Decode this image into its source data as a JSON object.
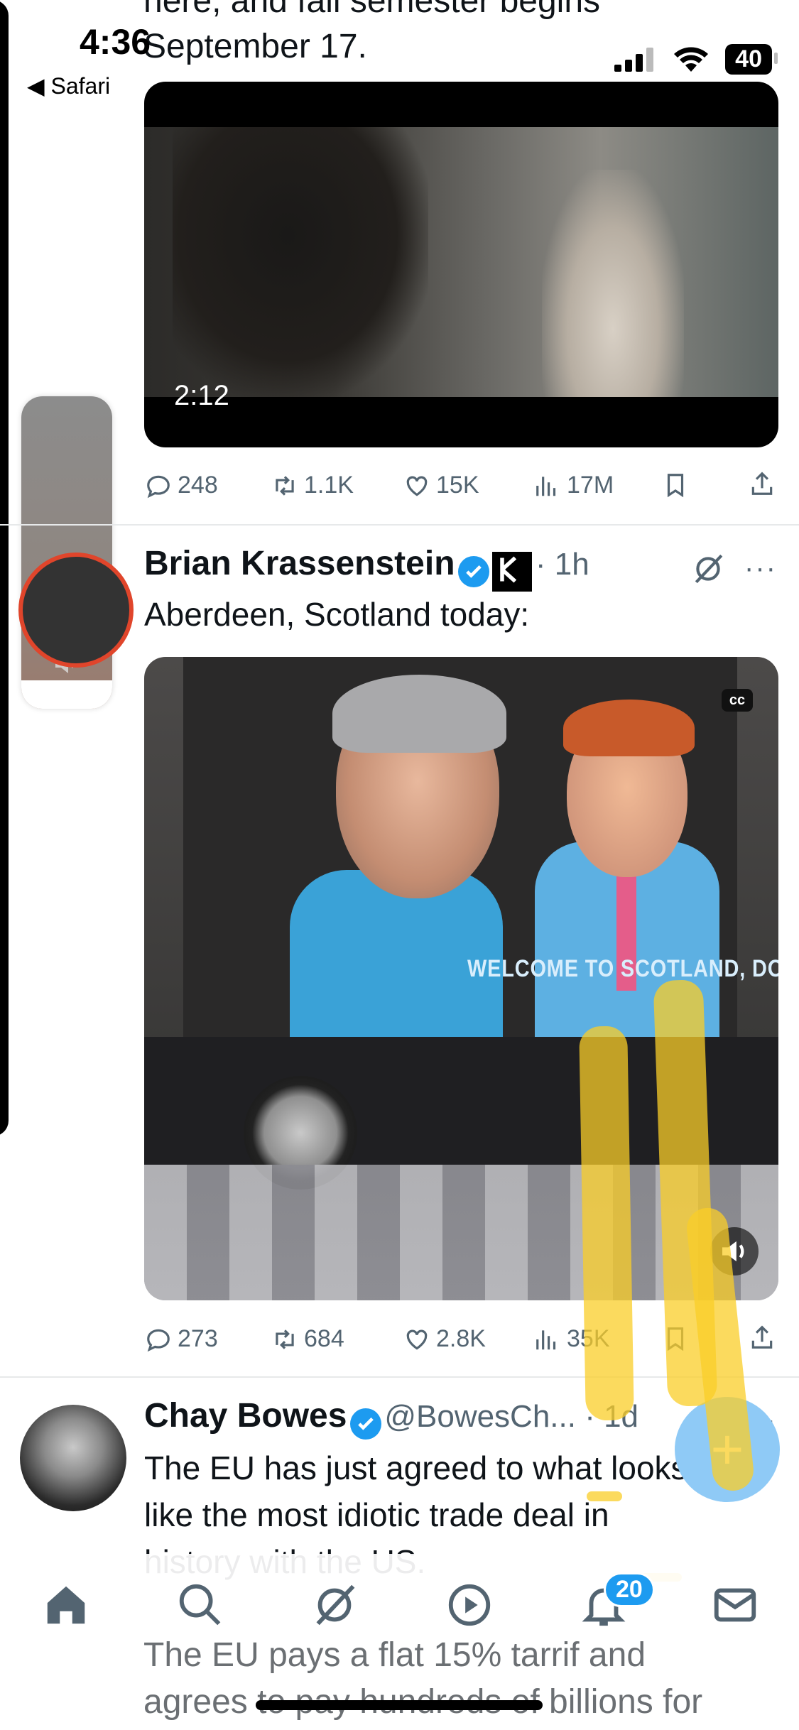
{
  "status_bar": {
    "time": "4:36",
    "back_label": "◀ Safari",
    "battery": "40"
  },
  "partial_tweet": {
    "text_line_1": "here, and fall semester begins",
    "text_line_2": "September 17."
  },
  "tweet_1_media": {
    "duration": "2:12"
  },
  "tweet_1_actions": {
    "replies": "248",
    "retweets": "1.1K",
    "likes": "15K",
    "views": "17M"
  },
  "tweet_2": {
    "author": "Brian Krassenstein",
    "meta": "· 1h",
    "text": "Aberdeen, Scotland today:",
    "video_caption": "WELCOME TO SCOTLAND, DONALD",
    "cc_label": "cc"
  },
  "tweet_2_actions": {
    "replies": "273",
    "retweets": "684",
    "likes": "2.8K",
    "views": "35K"
  },
  "tweet_3": {
    "author": "Chay Bowes",
    "handle": "@BowesCh... · 1d",
    "text_line_1": "The EU has just agreed to what looks",
    "text_line_2": "like the most idiotic trade deal in",
    "text_line_3": "history with the US.",
    "text_line_4": "The EU pays a flat 15% tarrif and",
    "text_line_5": "agrees to pay hundreds of billions for"
  },
  "bottom_nav": {
    "notification_count": "20"
  },
  "colors": {
    "accent": "#1d9bf0",
    "muted": "#536471",
    "fab": "#8fcaf6"
  }
}
